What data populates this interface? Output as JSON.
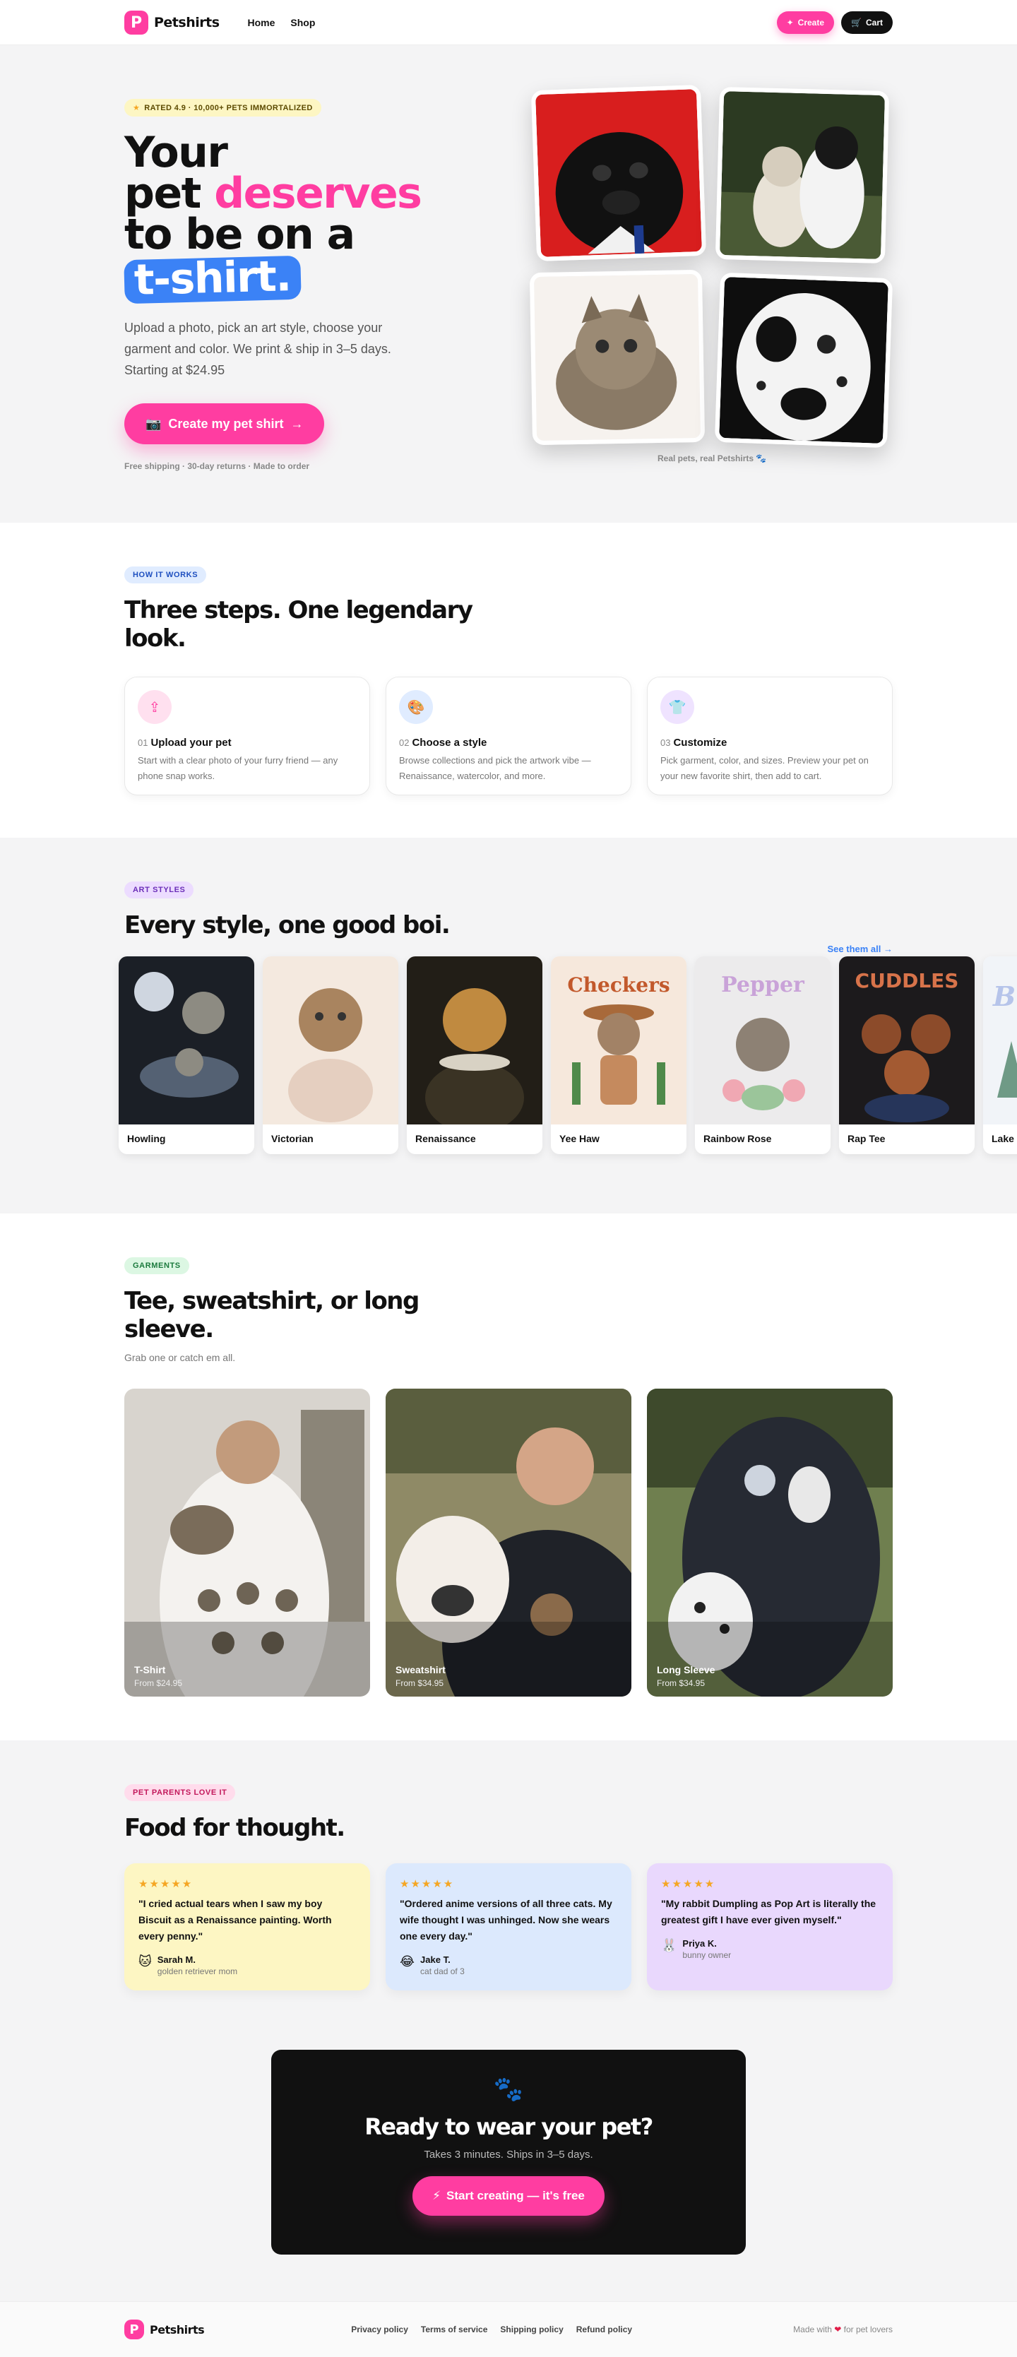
{
  "brand": {
    "name": "Petshirts",
    "mark": "P"
  },
  "nav": {
    "links": [
      "Home",
      "Shop"
    ],
    "create": "Create",
    "cart": "Cart"
  },
  "hero": {
    "rating": "RATED 4.9 · 10,000+ PETS IMMORTALIZED",
    "title_1": "Your",
    "title_2": "pet",
    "title_3": "deserves",
    "title_4": "to be on a",
    "title_5": "t-shirt.",
    "subtitle": "Upload a photo, pick an art style, choose your garment and color. We print & ship in 3–5 days. Starting at $24.95",
    "cta": "Create my pet shirt",
    "fine": "Free shipping · 30-day returns · Made to order",
    "caption": "Real pets, real Petshirts 🐾"
  },
  "how": {
    "tag": "HOW IT WORKS",
    "title": "Three steps. One legendary look.",
    "steps": [
      {
        "num": "01",
        "title": "Upload your pet",
        "text": "Start with a clear photo of your furry friend — any phone snap works."
      },
      {
        "num": "02",
        "title": "Choose a style",
        "text": "Browse collections and pick the artwork vibe — Renaissance, watercolor, and more."
      },
      {
        "num": "03",
        "title": "Customize",
        "text": "Pick garment, color, and sizes. Preview your pet on your new favorite shirt, then add to cart."
      }
    ]
  },
  "styles": {
    "tag": "ART STYLES",
    "title": "Every style, one good boi.",
    "see_all": "See them all",
    "items": [
      "Howling",
      "Victorian",
      "Renaissance",
      "Yee Haw",
      "Rainbow Rose",
      "Rap Tee",
      "Lake"
    ],
    "art_text": {
      "yeehaw": "Checkers",
      "rainbow": "Pepper",
      "rap": "CUDDLES"
    }
  },
  "garments": {
    "tag": "GARMENTS",
    "title": "Tee, sweatshirt, or long sleeve.",
    "subtitle": "Grab one or catch em all.",
    "items": [
      {
        "name": "T-Shirt",
        "price": "From $24.95"
      },
      {
        "name": "Sweatshirt",
        "price": "From $34.95"
      },
      {
        "name": "Long Sleeve",
        "price": "From $34.95"
      }
    ]
  },
  "reviews": {
    "tag": "PET PARENTS LOVE IT",
    "title": "Food for thought.",
    "stars": "★★★★★",
    "items": [
      {
        "quote": "\"I cried actual tears when I saw my boy Biscuit as a Renaissance painting. Worth every penny.\"",
        "emoji": "🐱",
        "name": "Sarah M.",
        "role": "golden retriever mom"
      },
      {
        "quote": "\"Ordered anime versions of all three cats. My wife thought I was unhinged. Now she wears one every day.\"",
        "emoji": "😂",
        "name": "Jake T.",
        "role": "cat dad of 3"
      },
      {
        "quote": "\"My rabbit Dumpling as Pop Art is literally the greatest gift I have ever given myself.\"",
        "emoji": "🐰",
        "name": "Priya K.",
        "role": "bunny owner"
      }
    ]
  },
  "cta": {
    "paw": "🐾",
    "title": "Ready to wear your pet?",
    "subtitle": "Takes 3 minutes. Ships in 3–5 days.",
    "button": "Start creating — it's free"
  },
  "footer": {
    "links": [
      "Privacy policy",
      "Terms of service",
      "Shipping policy",
      "Refund policy"
    ],
    "made_1": "Made with",
    "heart": "❤",
    "made_2": "for pet lovers"
  },
  "colors": {
    "accent": "#ff3da1",
    "blue": "#3b82f6",
    "dark": "#111111"
  }
}
